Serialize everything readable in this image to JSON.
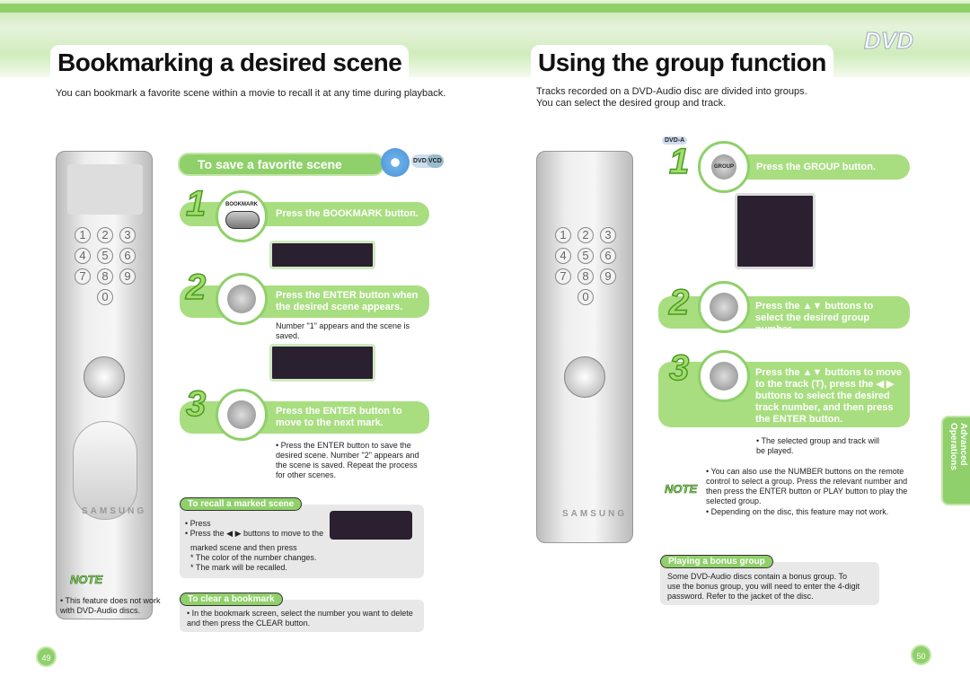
{
  "left": {
    "title": "Bookmarking a desired scene",
    "intro": "You can bookmark a favorite scene within a movie to recall it at any time during playback.",
    "section": "To save a favorite scene",
    "badges": [
      "DVD-V",
      "VCD"
    ],
    "steps": [
      {
        "num": "1",
        "button": "BOOKMARK",
        "text": "Press the BOOKMARK button.",
        "detail": ""
      },
      {
        "num": "2",
        "text": "Press the ENTER button when the desired scene appears.",
        "detail": "Number \"1\" appears and the scene is saved."
      },
      {
        "num": "3",
        "text": "Press the ENTER button to move to the next mark.",
        "detail": "• Press the ENTER button to save the desired scene. Number \"2\" appears and the scene is saved. Repeat the process for other scenes."
      }
    ],
    "recall": {
      "title": "To recall a marked scene",
      "lines": [
        "• Press",
        "• Press the ◀ ▶ buttons to move to the",
        "marked scene and then press",
        "* The color of the number changes.",
        "* The mark will be recalled."
      ]
    },
    "clear": {
      "title": "To clear a bookmark",
      "text": "• In the bookmark screen, select the number you want to delete and then press the CLEAR button."
    },
    "note_label": "NOTE",
    "note": "• This feature does not work with DVD-Audio discs.",
    "page": "49",
    "brand": "SAMSUNG"
  },
  "right": {
    "title": "Using the group function",
    "intro": [
      "Tracks recorded on a DVD-Audio disc are divided into groups.",
      "You can select the desired group and track."
    ],
    "badge": "DVD-A",
    "steps": [
      {
        "num": "1",
        "button": "GROUP",
        "text": "Press the GROUP button."
      },
      {
        "num": "2",
        "text": "Press the ▲▼ buttons to select the desired group number."
      },
      {
        "num": "3",
        "text": "Press the ▲▼ buttons to move to the track (T), press the ◀ ▶ buttons to select the desired track number, and then press the ENTER button."
      }
    ],
    "result": "• The selected group and track will be played.",
    "note_label": "NOTE",
    "notes": [
      "• You can also use the NUMBER buttons on the remote control to select a group. Press the relevant number and then press the ENTER button or PLAY button to play the selected group.",
      "• Depending on the disc, this feature may not work."
    ],
    "bonus": {
      "title": "Playing a bonus group",
      "text": "Some DVD-Audio discs contain a bonus group. To use the bonus group, you will need to enter the 4-digit password. Refer to the jacket of the disc."
    },
    "side_tab": "Advanced Operations",
    "page": "50",
    "brand": "SAMSUNG",
    "logo": "DVD"
  },
  "remote_keys": [
    "1",
    "2",
    "3",
    "4",
    "5",
    "6",
    "7",
    "8",
    "9",
    "0"
  ],
  "colors": {
    "accent": "#8fd06a",
    "step_banner": "#a8de80"
  }
}
